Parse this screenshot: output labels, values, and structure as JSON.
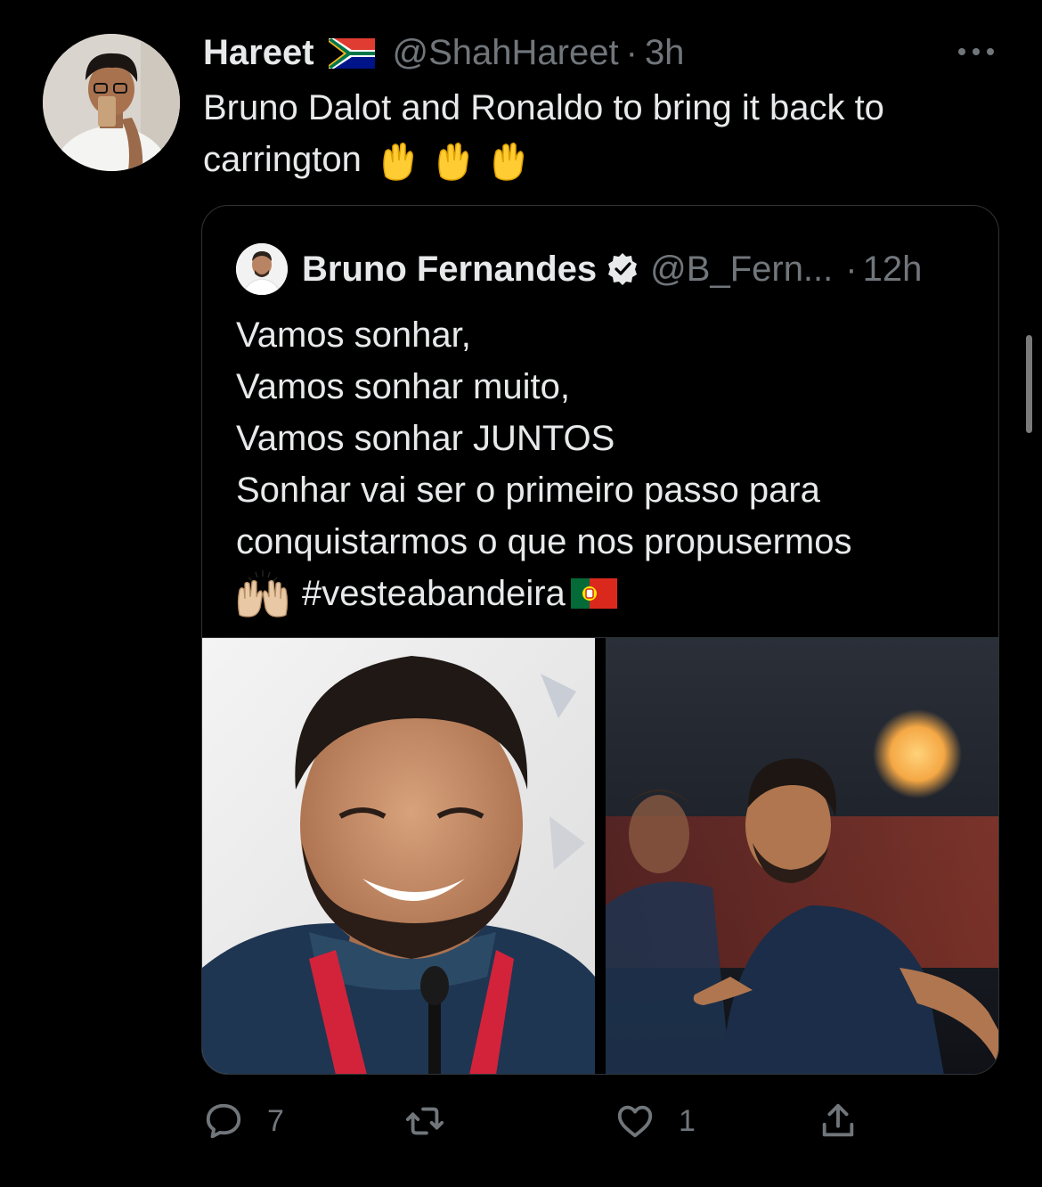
{
  "tweet": {
    "author_name": "Hareet",
    "flag": "south-africa-flag",
    "handle": "@ShahHareet",
    "separator": "·",
    "time": "3h",
    "text": "Bruno Dalot and Ronaldo to bring it back to carrington",
    "emoji": "raised-hands-emoji x3"
  },
  "quoted_tweet": {
    "author_name": "Bruno Fernandes",
    "verified": true,
    "handle": "@B_Fern...",
    "separator": "·",
    "time": "12h",
    "lines": [
      "Vamos sonhar,",
      "Vamos sonhar muito,",
      "Vamos sonhar JUNTOS",
      "Sonhar vai ser o primeiro passo para",
      "conquistarmos o que nos propusermos"
    ],
    "hashtag": "#vesteabandeira",
    "hashtag_emoji_before": "raising-hands-emoji",
    "hashtag_emoji_after": "portugal-flag"
  },
  "actions": {
    "reply_count": "7",
    "retweet_count": "",
    "like_count": "1"
  },
  "colors": {
    "background": "#000000",
    "text_primary": "#e7e9ea",
    "text_secondary": "#71767b",
    "border": "#2f3336"
  }
}
